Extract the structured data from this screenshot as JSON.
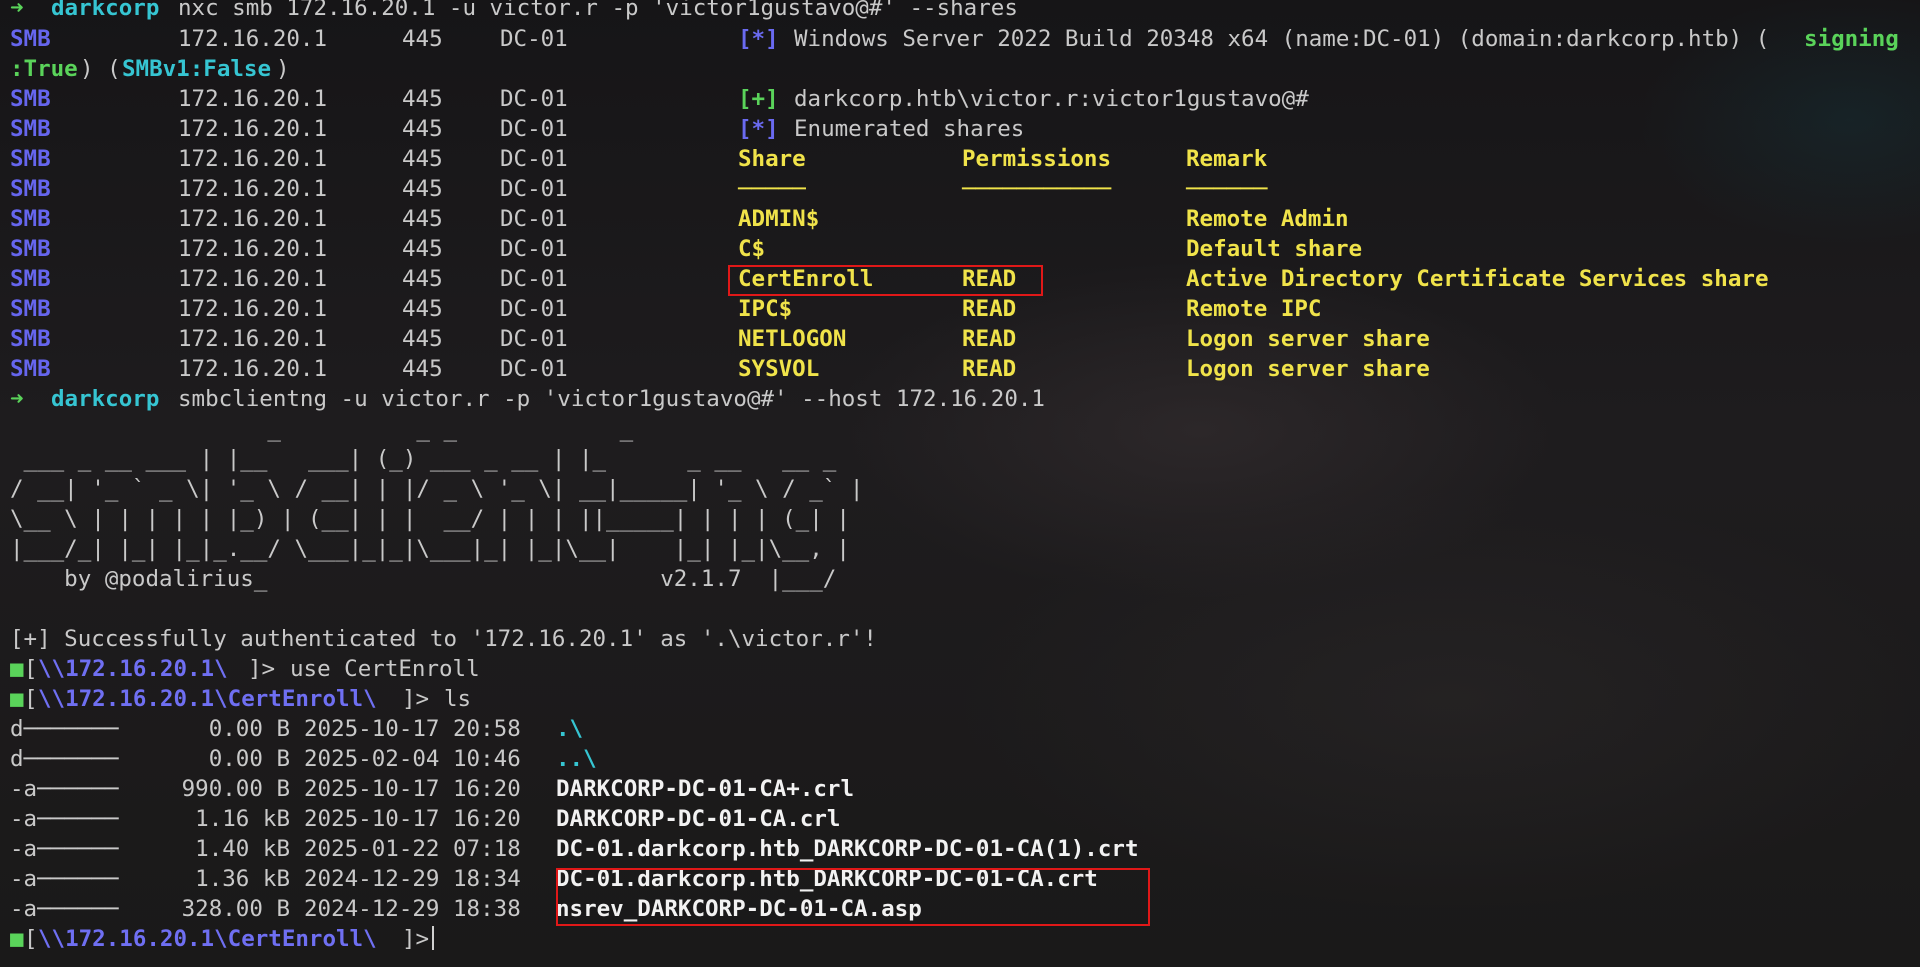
{
  "nxc_cmd": {
    "prompt": "➜",
    "dir": "darkcorp",
    "command": "nxc smb 172.16.20.1 -u victor.r -p 'victor1gustavo@#' --shares"
  },
  "smb": {
    "proto": "SMB",
    "ip": "172.16.20.1",
    "port": "445",
    "host": "DC-01",
    "info_tag": "[*]",
    "info_text": "Windows Server 2022 Build 20348 x64 (name:DC-01) (domain:darkcorp.htb) (",
    "signing_a": "signing",
    "wrap_b": ":True",
    "wrap_c": ") (",
    "smbv1": "SMBv1:False",
    "wrap_d": ")",
    "auth_tag": "[+]",
    "auth_text": "darkcorp.htb\\victor.r:victor1gustavo@#",
    "enum_tag": "[*]",
    "enum_text": "Enumerated shares",
    "headers": {
      "share": "Share",
      "perm": "Permissions",
      "remark": "Remark",
      "uline_share": "─────",
      "uline_perm": "───────────",
      "uline_remark": "──────"
    },
    "shares": [
      {
        "name": "ADMIN$",
        "perm": "",
        "remark": "Remote Admin"
      },
      {
        "name": "C$",
        "perm": "",
        "remark": "Default share"
      },
      {
        "name": "CertEnroll",
        "perm": "READ",
        "remark": "Active Directory Certificate Services share"
      },
      {
        "name": "IPC$",
        "perm": "READ",
        "remark": "Remote IPC"
      },
      {
        "name": "NETLOGON",
        "perm": "READ",
        "remark": "Logon server share"
      },
      {
        "name": "SYSVOL",
        "perm": "READ",
        "remark": "Logon server share"
      }
    ]
  },
  "smbclient_cmd": {
    "prompt": "➜",
    "dir": "darkcorp",
    "command": "smbclientng -u victor.r -p 'victor1gustavo@#' --host 172.16.20.1"
  },
  "banner": [
    "                   _          _ _            _",
    " ___ _ __ ___ | |__   ___| (_) ___ _ __ | |_      _ __   __ _",
    "/ __| '_ ` _ \\| '_ \\ / __| | |/ _ \\ '_ \\| __|_____| '_ \\ / _` |",
    "\\__ \\ | | | | | |_) | (__| | |  __/ | | | ||_____| | | | (_| |",
    "|___/_| |_| |_|_.__/ \\___|_|_|\\___|_| |_|\\__|    |_| |_|\\__, |",
    "    by @podalirius_                             v2.1.7  |___/"
  ],
  "auth_msg": "[+] Successfully authenticated to '172.16.20.1' as '.\\victor.r'!",
  "session": {
    "marker": "■",
    "prompt1_open": "[",
    "prompt1_path": "\\\\172.16.20.1\\",
    "prompt1_close": "]> ",
    "cmd1": "use CertEnroll",
    "prompt2_open": "[",
    "prompt2_path": "\\\\172.16.20.1\\CertEnroll\\",
    "prompt2_close": "]> ",
    "cmd2": "ls",
    "prompt3_open": "[",
    "prompt3_path": "\\\\172.16.20.1\\CertEnroll\\",
    "prompt3_close": "]> "
  },
  "listing": [
    {
      "attr": "d───────",
      "size": "0.00 B",
      "date": "2025-10-17 20:58",
      "name": ".\\",
      "kind": "dir"
    },
    {
      "attr": "d───────",
      "size": "0.00 B",
      "date": "2025-02-04 10:46",
      "name": "..\\",
      "kind": "dir"
    },
    {
      "attr": "-a──────",
      "size": "990.00 B",
      "date": "2025-10-17 16:20",
      "name": "DARKCORP-DC-01-CA+.crl",
      "kind": "file"
    },
    {
      "attr": "-a──────",
      "size": "1.16 kB",
      "date": "2025-10-17 16:20",
      "name": "DARKCORP-DC-01-CA.crl",
      "kind": "file"
    },
    {
      "attr": "-a──────",
      "size": "1.40 kB",
      "date": "2025-01-22 07:18",
      "name": "DC-01.darkcorp.htb_DARKCORP-DC-01-CA(1).crt",
      "kind": "file"
    },
    {
      "attr": "-a──────",
      "size": "1.36 kB",
      "date": "2024-12-29 18:34",
      "name": "DC-01.darkcorp.htb_DARKCORP-DC-01-CA.crt",
      "kind": "file"
    },
    {
      "attr": "-a──────",
      "size": "328.00 B",
      "date": "2024-12-29 18:38",
      "name": "nsrev_DARKCORP-DC-01-CA.asp",
      "kind": "file"
    }
  ],
  "colors": {
    "bg": "#1b1a1c",
    "green": "#5ad35a",
    "cyan": "#36c5d2",
    "yellow": "#f0e34a",
    "blue": "#6666ee",
    "text": "#c9c9c9",
    "highlight": "#e01818"
  }
}
